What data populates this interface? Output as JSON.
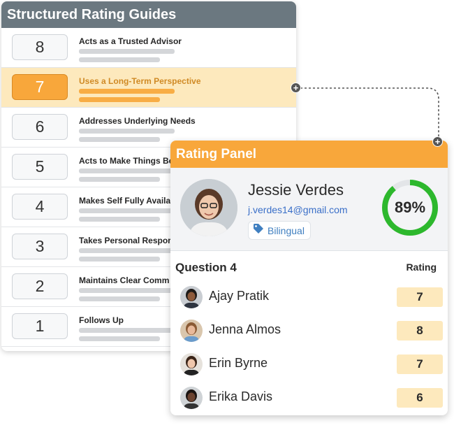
{
  "guides": {
    "title": "Structured Rating Guides",
    "rows": [
      {
        "score": "8",
        "label": "Acts as a Trusted Advisor",
        "selected": false
      },
      {
        "score": "7",
        "label": "Uses a Long-Term Perspective",
        "selected": true
      },
      {
        "score": "6",
        "label": "Addresses Underlying Needs",
        "selected": false
      },
      {
        "score": "5",
        "label": "Acts to Make Things Be",
        "selected": false
      },
      {
        "score": "4",
        "label": "Makes Self Fully Availa",
        "selected": false
      },
      {
        "score": "3",
        "label": "Takes Personal Respor",
        "selected": false
      },
      {
        "score": "2",
        "label": "Maintains Clear Comm",
        "selected": false
      },
      {
        "score": "1",
        "label": "Follows Up",
        "selected": false
      }
    ]
  },
  "panel": {
    "title": "Rating Panel",
    "candidate": {
      "name": "Jessie Verdes",
      "email": "j.verdes14@gmail.com",
      "tag": "Bilingual",
      "score_label": "89%",
      "score_fraction": 0.89
    },
    "question_title": "Question 4",
    "rating_header": "Rating",
    "raters": [
      {
        "name": "Ajay Pratik",
        "score": "7",
        "skin": "#8d5a3b",
        "hair": "#1d1a18",
        "shirt": "#2e3440",
        "bg": "#c9cdd2"
      },
      {
        "name": "Jenna Almos",
        "score": "8",
        "skin": "#e8b99a",
        "hair": "#8a5a34",
        "shirt": "#6a9ccc",
        "bg": "#d9c6ad"
      },
      {
        "name": "Erin Byrne",
        "score": "7",
        "skin": "#f0c7ac",
        "hair": "#3a2418",
        "shirt": "#222222",
        "bg": "#e6e2dc"
      },
      {
        "name": "Erika Davis",
        "score": "6",
        "skin": "#6b4330",
        "hair": "#1a1412",
        "shirt": "#333333",
        "bg": "#cfd3d6"
      }
    ]
  },
  "colors": {
    "accent_orange": "#f8a73b",
    "header_gray": "#6b7880",
    "donut_green": "#2db82d",
    "link_blue": "#3a6fc8"
  },
  "icons": [
    "plus-icon",
    "tag-icon",
    "avatar"
  ]
}
